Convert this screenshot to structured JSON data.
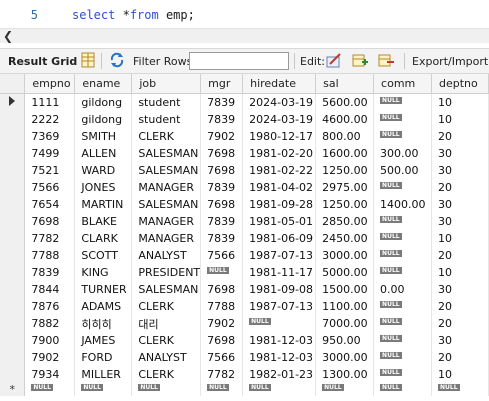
{
  "editor": {
    "line_number": "5",
    "keyword_select": "select",
    "code_rest": " *",
    "keyword_from": "from",
    "code_tail": " emp;"
  },
  "toolbar": {
    "result_grid": "Result Grid",
    "filter_rows": "Filter Rows:",
    "edit": "Edit:",
    "export_import": "Export/Import:"
  },
  "icons": {
    "scroll_left": "scroll-left-icon",
    "grid_layout": "grid-layout-icon",
    "refresh": "refresh-icon",
    "edit_row": "edit-row-icon",
    "add_row": "add-row-icon",
    "delete_row": "delete-row-icon"
  },
  "null_label": "NULL",
  "grid": {
    "columns": [
      "empno",
      "ename",
      "job",
      "mgr",
      "hiredate",
      "sal",
      "comm",
      "deptno"
    ],
    "rows": [
      [
        "1111",
        "gildong",
        "student",
        "7839",
        "2024-03-19",
        "5600.00",
        null,
        "10"
      ],
      [
        "2222",
        "gildong",
        "student",
        "7839",
        "2024-03-19",
        "4600.00",
        null,
        "10"
      ],
      [
        "7369",
        "SMITH",
        "CLERK",
        "7902",
        "1980-12-17",
        "800.00",
        null,
        "20"
      ],
      [
        "7499",
        "ALLEN",
        "SALESMAN",
        "7698",
        "1981-02-20",
        "1600.00",
        "300.00",
        "30"
      ],
      [
        "7521",
        "WARD",
        "SALESMAN",
        "7698",
        "1981-02-22",
        "1250.00",
        "500.00",
        "30"
      ],
      [
        "7566",
        "JONES",
        "MANAGER",
        "7839",
        "1981-04-02",
        "2975.00",
        null,
        "20"
      ],
      [
        "7654",
        "MARTIN",
        "SALESMAN",
        "7698",
        "1981-09-28",
        "1250.00",
        "1400.00",
        "30"
      ],
      [
        "7698",
        "BLAKE",
        "MANAGER",
        "7839",
        "1981-05-01",
        "2850.00",
        null,
        "30"
      ],
      [
        "7782",
        "CLARK",
        "MANAGER",
        "7839",
        "1981-06-09",
        "2450.00",
        null,
        "10"
      ],
      [
        "7788",
        "SCOTT",
        "ANALYST",
        "7566",
        "1987-07-13",
        "3000.00",
        null,
        "20"
      ],
      [
        "7839",
        "KING",
        "PRESIDENT",
        null,
        "1981-11-17",
        "5000.00",
        null,
        "10"
      ],
      [
        "7844",
        "TURNER",
        "SALESMAN",
        "7698",
        "1981-09-08",
        "1500.00",
        "0.00",
        "30"
      ],
      [
        "7876",
        "ADAMS",
        "CLERK",
        "7788",
        "1987-07-13",
        "1100.00",
        null,
        "20"
      ],
      [
        "7882",
        "히히히",
        "대리",
        "7902",
        null,
        "7000.00",
        null,
        "20"
      ],
      [
        "7900",
        "JAMES",
        "CLERK",
        "7698",
        "1981-12-03",
        "950.00",
        null,
        "30"
      ],
      [
        "7902",
        "FORD",
        "ANALYST",
        "7566",
        "1981-12-03",
        "3000.00",
        null,
        "20"
      ],
      [
        "7934",
        "MILLER",
        "CLERK",
        "7782",
        "1982-01-23",
        "1300.00",
        null,
        "10"
      ]
    ],
    "new_row_marker": "*"
  }
}
